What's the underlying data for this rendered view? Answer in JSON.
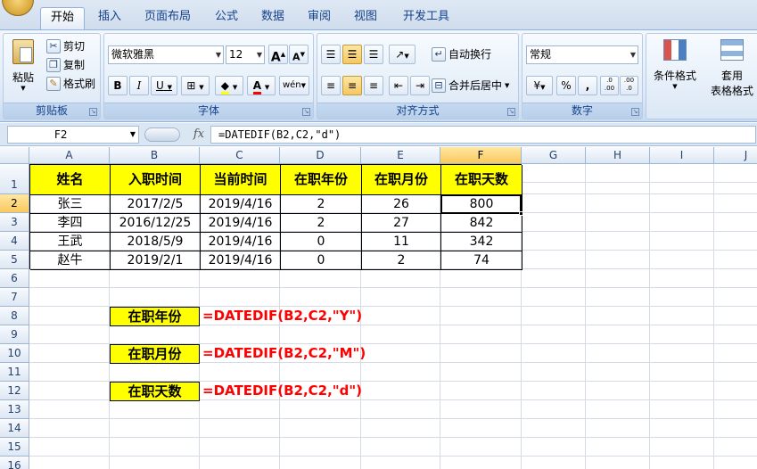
{
  "tabs": [
    {
      "label": "开始",
      "active": true
    },
    {
      "label": "插入"
    },
    {
      "label": "页面布局"
    },
    {
      "label": "公式"
    },
    {
      "label": "数据"
    },
    {
      "label": "审阅"
    },
    {
      "label": "视图"
    },
    {
      "label": "开发工具"
    }
  ],
  "ribbon": {
    "clipboard": {
      "paste": "粘贴",
      "cut": "剪切",
      "copy": "复制",
      "format_painter": "格式刷",
      "label": "剪贴板"
    },
    "font": {
      "name": "微软雅黑",
      "size": "12",
      "label": "字体",
      "bold": "B",
      "italic": "I",
      "underline": "U",
      "grow": "A",
      "shrink": "A",
      "phonetic": "wén"
    },
    "alignment": {
      "wrap": "自动换行",
      "merge": "合并后居中",
      "label": "对齐方式"
    },
    "number": {
      "format": "常规",
      "percent": "%",
      "comma": ",",
      "inc_decimal": ".0 .00",
      "dec_decimal": ".00 .0",
      "label": "数字"
    },
    "styles": {
      "conditional": "条件格式",
      "table_l1": "套用",
      "table_l2": "表格格式"
    }
  },
  "formula_bar": {
    "name_box": "F2",
    "fx": "fx",
    "formula": "=DATEDIF(B2,C2,\"d\")"
  },
  "columns": [
    "A",
    "B",
    "C",
    "D",
    "E",
    "F",
    "G",
    "H",
    "I",
    "J"
  ],
  "rows": [
    "1",
    "2",
    "3",
    "4",
    "5",
    "6",
    "7",
    "8",
    "9",
    "10",
    "11",
    "12",
    "13",
    "14",
    "15",
    "16"
  ],
  "table": {
    "headers": [
      "姓名",
      "入职时间",
      "当前时间",
      "在职年份",
      "在职月份",
      "在职天数"
    ],
    "rows": [
      [
        "张三",
        "2017/2/5",
        "2019/4/16",
        "2",
        "26",
        "800"
      ],
      [
        "李四",
        "2016/12/25",
        "2019/4/16",
        "2",
        "27",
        "842"
      ],
      [
        "王武",
        "2018/5/9",
        "2019/4/16",
        "0",
        "11",
        "342"
      ],
      [
        "赵牛",
        "2019/2/1",
        "2019/4/16",
        "0",
        "2",
        "74"
      ]
    ]
  },
  "notes": [
    {
      "label": "在职年份",
      "formula": "=DATEDIF(B2,C2,\"Y\")"
    },
    {
      "label": "在职月份",
      "formula": "=DATEDIF(B2,C2,\"M\")"
    },
    {
      "label": "在职天数",
      "formula": "=DATEDIF(B2,C2,\"d\")"
    }
  ],
  "colors": {
    "header_fill": "#ffff00",
    "formula_text": "#ff0000",
    "ribbon_text": "#15428b"
  }
}
